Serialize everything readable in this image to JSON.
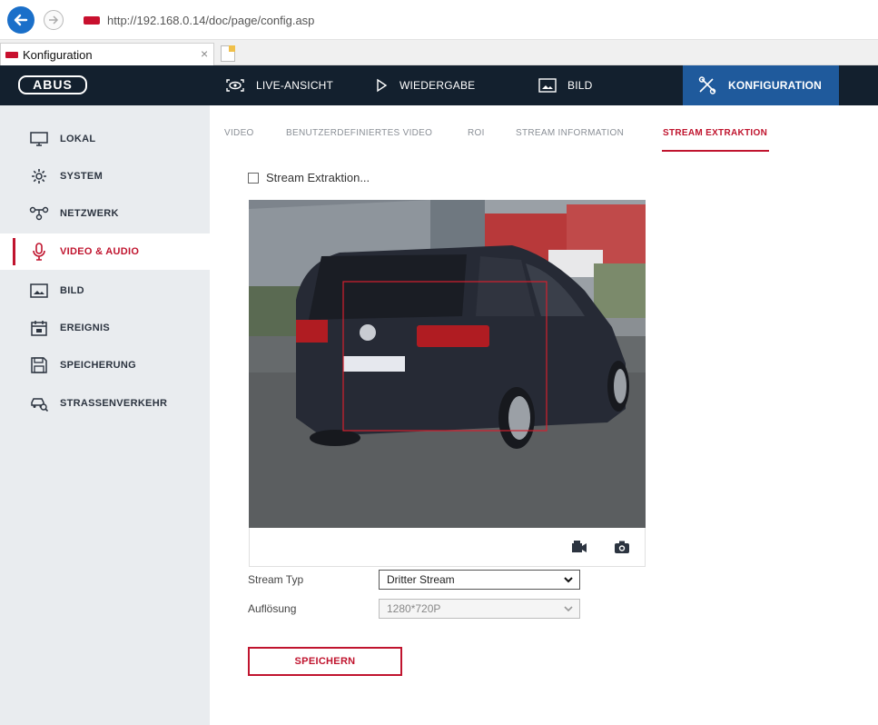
{
  "browser": {
    "url": "http://192.168.0.14/doc/page/config.asp",
    "tab_title": "Konfiguration",
    "tab_close": "×"
  },
  "brand": {
    "logo": "ABUS"
  },
  "top_nav": [
    {
      "label": "LIVE-ANSICHT",
      "icon": "eye-icon"
    },
    {
      "label": "WIEDERGABE",
      "icon": "play-icon"
    },
    {
      "label": "BILD",
      "icon": "image-icon"
    },
    {
      "label": "KONFIGURATION",
      "icon": "tools-icon",
      "active": true
    }
  ],
  "sidebar": {
    "items": [
      {
        "label": "LOKAL",
        "icon": "monitor-icon"
      },
      {
        "label": "SYSTEM",
        "icon": "gear-icon"
      },
      {
        "label": "NETZWERK",
        "icon": "network-icon"
      },
      {
        "label": "VIDEO & AUDIO",
        "icon": "microphone-icon",
        "active": true
      },
      {
        "label": "BILD",
        "icon": "image-icon"
      },
      {
        "label": "EREIGNIS",
        "icon": "calendar-icon"
      },
      {
        "label": "SPEICHERUNG",
        "icon": "disk-icon"
      },
      {
        "label": "STRAßENVERKEHR",
        "icon": "car-search-icon"
      }
    ]
  },
  "sub_tabs": [
    {
      "label": "VIDEO"
    },
    {
      "label": "BENUTZERDEFINIERTES VIDEO"
    },
    {
      "label": "ROI"
    },
    {
      "label": "STREAM INFORMATION"
    },
    {
      "label": "STREAM EXTRAKTION",
      "active": true
    }
  ],
  "stream_extraction": {
    "checkbox_label": "Stream Extraktion...",
    "checked": false
  },
  "form": {
    "stream_type": {
      "label": "Stream Typ",
      "value": "Dritter Stream"
    },
    "resolution": {
      "label": "Auflösung",
      "value": "1280*720P",
      "disabled": true
    }
  },
  "save_label": "SPEICHERN",
  "colors": {
    "accent_red": "#c0142e",
    "nav_dark": "#13202e",
    "nav_active": "#1f5a9c",
    "sidebar_bg": "#e9ecef"
  }
}
